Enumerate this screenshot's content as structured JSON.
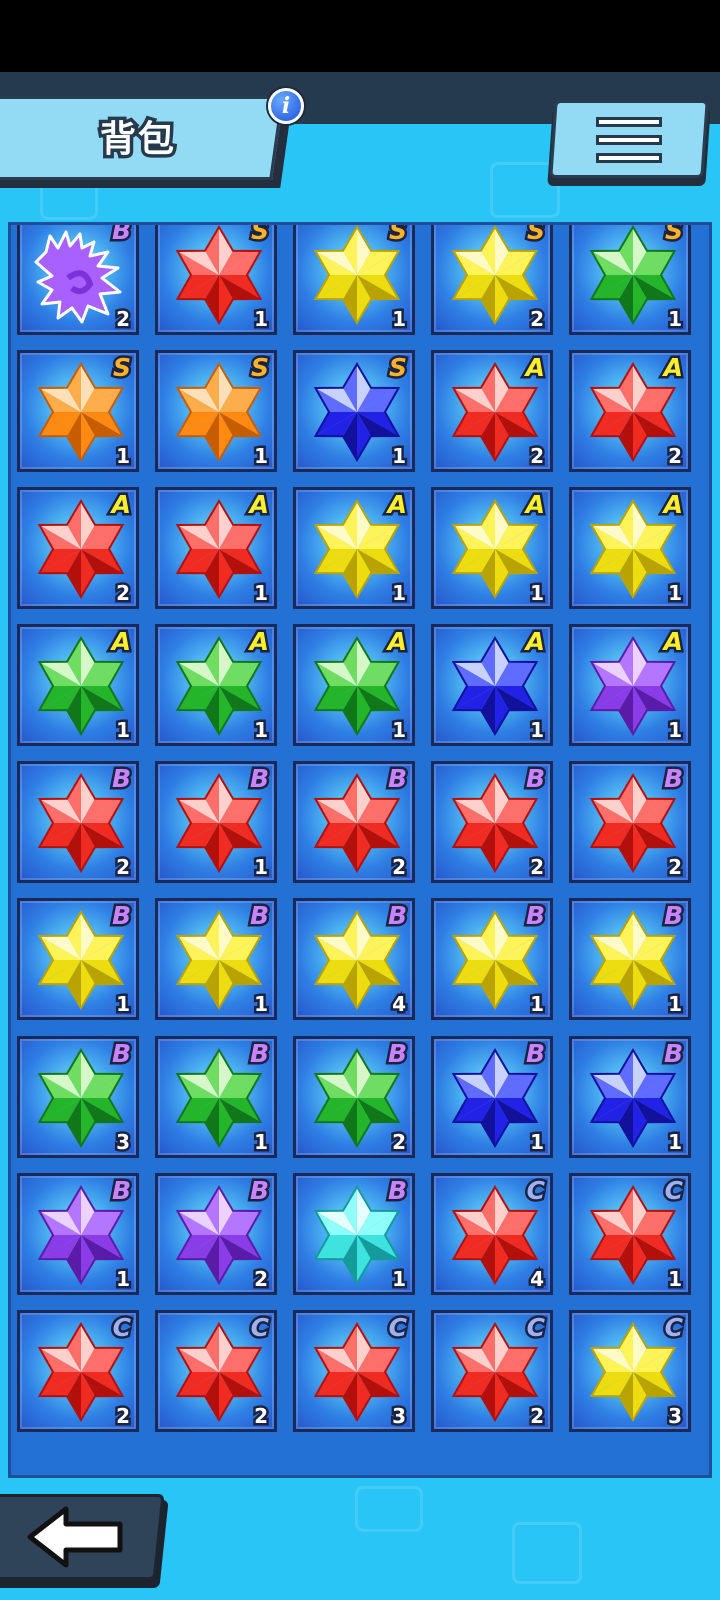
{
  "header": {
    "title": "背包",
    "info_icon": "info-icon",
    "menu_icon": "hamburger-menu-icon"
  },
  "colors": {
    "background": "#29c5f6",
    "panel": "#2471d6",
    "rank_S": "#ffb12a",
    "rank_A": "#ffee2a",
    "rank_B": "#c983ff",
    "rank_C": "#9fb1f4"
  },
  "inventory": {
    "slots": [
      {
        "item": "dragon-silhouette",
        "rank": "B",
        "count": "2"
      },
      {
        "item": "red",
        "rank": "S",
        "count": "1"
      },
      {
        "item": "yellow",
        "rank": "S",
        "count": "1"
      },
      {
        "item": "yellow",
        "rank": "S",
        "count": "2"
      },
      {
        "item": "green",
        "rank": "S",
        "count": "1"
      },
      {
        "item": "orange",
        "rank": "S",
        "count": "1"
      },
      {
        "item": "orange",
        "rank": "S",
        "count": "1"
      },
      {
        "item": "blue",
        "rank": "S",
        "count": "1"
      },
      {
        "item": "red",
        "rank": "A",
        "count": "2"
      },
      {
        "item": "red",
        "rank": "A",
        "count": "2"
      },
      {
        "item": "red",
        "rank": "A",
        "count": "2"
      },
      {
        "item": "red",
        "rank": "A",
        "count": "1"
      },
      {
        "item": "yellow",
        "rank": "A",
        "count": "1"
      },
      {
        "item": "yellow",
        "rank": "A",
        "count": "1"
      },
      {
        "item": "yellow",
        "rank": "A",
        "count": "1"
      },
      {
        "item": "green",
        "rank": "A",
        "count": "1"
      },
      {
        "item": "green",
        "rank": "A",
        "count": "1"
      },
      {
        "item": "green",
        "rank": "A",
        "count": "1"
      },
      {
        "item": "blue",
        "rank": "A",
        "count": "1"
      },
      {
        "item": "purple",
        "rank": "A",
        "count": "1"
      },
      {
        "item": "red",
        "rank": "B",
        "count": "2"
      },
      {
        "item": "red",
        "rank": "B",
        "count": "1"
      },
      {
        "item": "red",
        "rank": "B",
        "count": "2"
      },
      {
        "item": "red",
        "rank": "B",
        "count": "2"
      },
      {
        "item": "red",
        "rank": "B",
        "count": "2"
      },
      {
        "item": "yellow",
        "rank": "B",
        "count": "1"
      },
      {
        "item": "yellow",
        "rank": "B",
        "count": "1"
      },
      {
        "item": "yellow",
        "rank": "B",
        "count": "4"
      },
      {
        "item": "yellow",
        "rank": "B",
        "count": "1"
      },
      {
        "item": "yellow",
        "rank": "B",
        "count": "1"
      },
      {
        "item": "green",
        "rank": "B",
        "count": "3"
      },
      {
        "item": "green",
        "rank": "B",
        "count": "1"
      },
      {
        "item": "green",
        "rank": "B",
        "count": "2"
      },
      {
        "item": "blue",
        "rank": "B",
        "count": "1"
      },
      {
        "item": "blue",
        "rank": "B",
        "count": "1"
      },
      {
        "item": "purple",
        "rank": "B",
        "count": "1"
      },
      {
        "item": "purple",
        "rank": "B",
        "count": "2"
      },
      {
        "item": "cyan",
        "rank": "B",
        "count": "1"
      },
      {
        "item": "red",
        "rank": "C",
        "count": "4"
      },
      {
        "item": "red",
        "rank": "C",
        "count": "1"
      },
      {
        "item": "red",
        "rank": "C",
        "count": "2"
      },
      {
        "item": "red",
        "rank": "C",
        "count": "2"
      },
      {
        "item": "red",
        "rank": "C",
        "count": "3"
      },
      {
        "item": "red",
        "rank": "C",
        "count": "2"
      },
      {
        "item": "yellow",
        "rank": "C",
        "count": "3"
      }
    ]
  },
  "footer": {
    "back_icon": "back-arrow-icon"
  }
}
